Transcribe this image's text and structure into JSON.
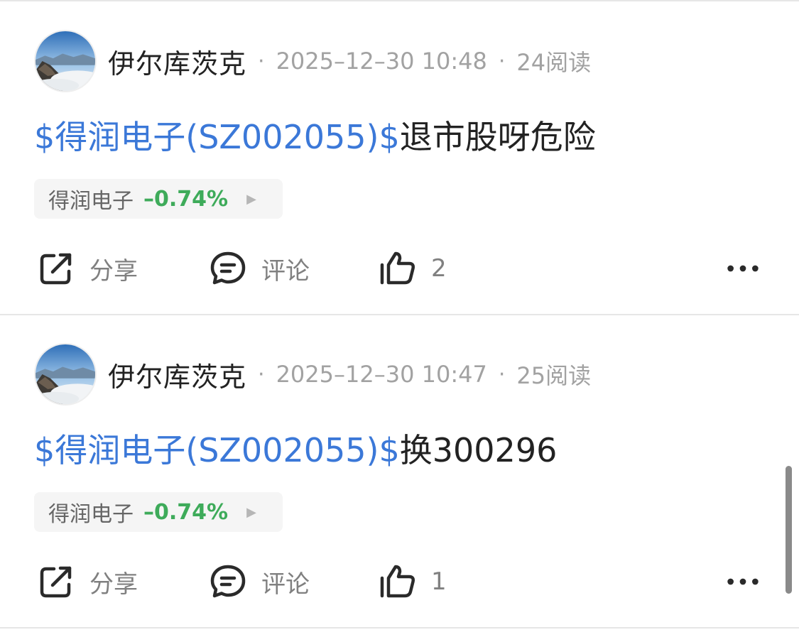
{
  "posts": [
    {
      "author": "伊尔库茨克",
      "separator": "·",
      "date": "2025–12–30 10:48",
      "reads": "24阅读",
      "stock_link": "$得润电子(SZ002055)$",
      "text": "退市股呀危险",
      "stock_chip": {
        "name": "得润电子",
        "change": "–0.74%"
      },
      "actions": {
        "share": "分享",
        "comment": "评论",
        "likes": "2"
      }
    },
    {
      "author": "伊尔库茨克",
      "separator": "·",
      "date": "2025–12–30 10:47",
      "reads": "25阅读",
      "stock_link": "$得润电子(SZ002055)$",
      "text": "换300296",
      "stock_chip": {
        "name": "得润电子",
        "change": "–0.74%"
      },
      "actions": {
        "share": "分享",
        "comment": "评论",
        "likes": "1"
      }
    }
  ],
  "colors": {
    "link": "#3b78d8",
    "negative_change": "#3eab5a",
    "meta_text": "#a2a2a2"
  },
  "icons": [
    "avatar-image",
    "share-icon",
    "comment-icon",
    "like-icon",
    "more-icon",
    "chevron-right-icon"
  ]
}
